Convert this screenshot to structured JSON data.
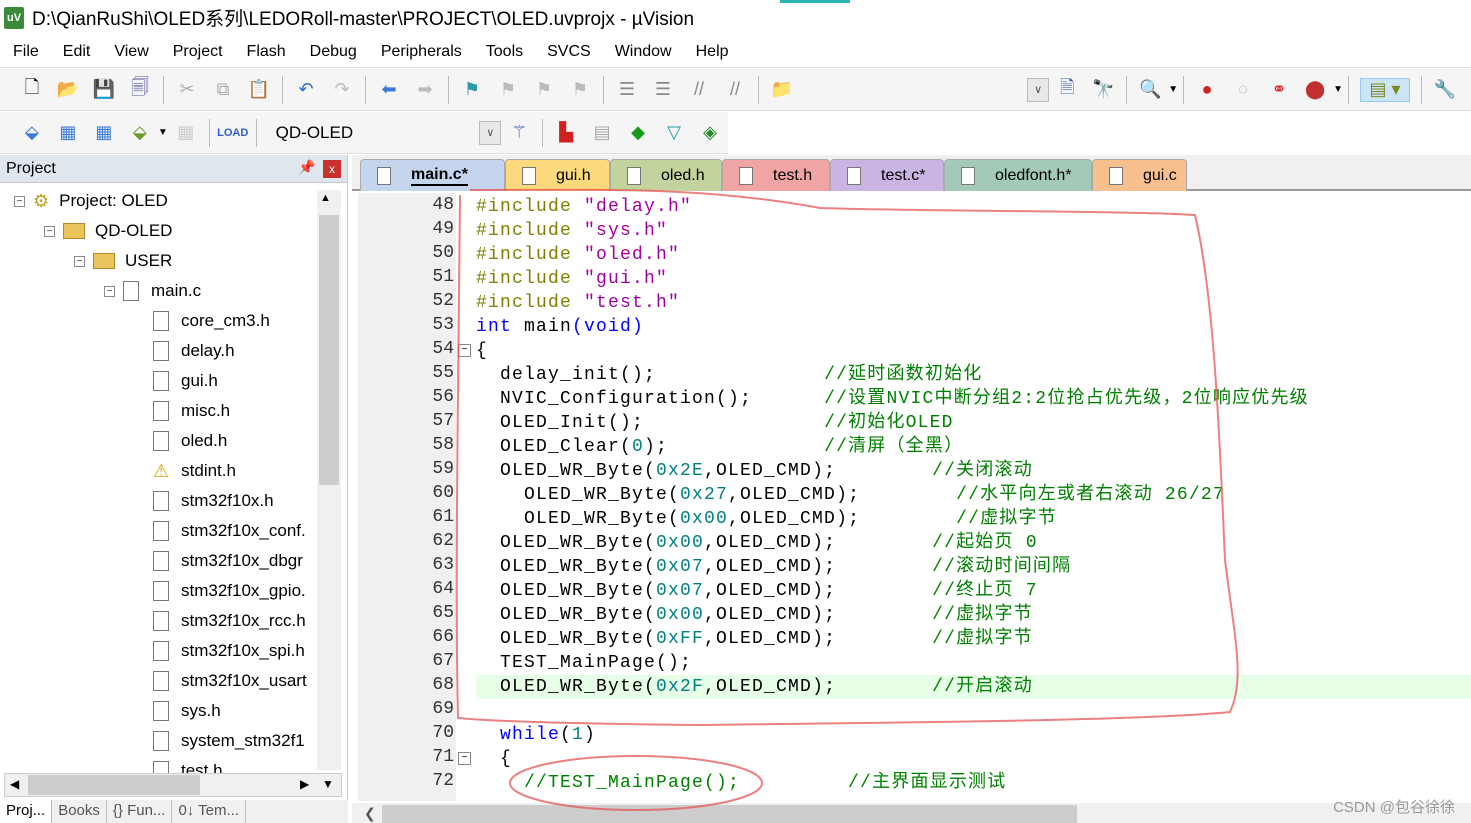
{
  "window": {
    "title": "D:\\QianRuShi\\OLED系列\\LEDORoll-master\\PROJECT\\OLED.uvprojx - µVision",
    "app_icon": "uv"
  },
  "menu": [
    "File",
    "Edit",
    "View",
    "Project",
    "Flash",
    "Debug",
    "Peripherals",
    "Tools",
    "SVCS",
    "Window",
    "Help"
  ],
  "toolbar2": {
    "target": "QD-OLED"
  },
  "project": {
    "title": "Project",
    "pin": "⊥",
    "close": "x",
    "tree": [
      {
        "label": "Project: OLED",
        "level": 0,
        "kind": "project",
        "exp": "−"
      },
      {
        "label": "QD-OLED",
        "level": 1,
        "kind": "folder",
        "exp": "−"
      },
      {
        "label": "USER",
        "level": 2,
        "kind": "folder",
        "exp": "−"
      },
      {
        "label": "main.c",
        "level": 3,
        "kind": "file",
        "exp": "−"
      },
      {
        "label": "core_cm3.h",
        "level": 4,
        "kind": "file"
      },
      {
        "label": "delay.h",
        "level": 4,
        "kind": "file"
      },
      {
        "label": "gui.h",
        "level": 4,
        "kind": "file"
      },
      {
        "label": "misc.h",
        "level": 4,
        "kind": "file"
      },
      {
        "label": "oled.h",
        "level": 4,
        "kind": "file"
      },
      {
        "label": "stdint.h",
        "level": 4,
        "kind": "warn"
      },
      {
        "label": "stm32f10x.h",
        "level": 4,
        "kind": "file"
      },
      {
        "label": "stm32f10x_conf.",
        "level": 4,
        "kind": "file"
      },
      {
        "label": "stm32f10x_dbgr",
        "level": 4,
        "kind": "file"
      },
      {
        "label": "stm32f10x_gpio.",
        "level": 4,
        "kind": "file"
      },
      {
        "label": "stm32f10x_rcc.h",
        "level": 4,
        "kind": "file"
      },
      {
        "label": "stm32f10x_spi.h",
        "level": 4,
        "kind": "file"
      },
      {
        "label": "stm32f10x_usart",
        "level": 4,
        "kind": "file"
      },
      {
        "label": "sys.h",
        "level": 4,
        "kind": "file"
      },
      {
        "label": "system_stm32f1",
        "level": 4,
        "kind": "file"
      },
      {
        "label": "test.h",
        "level": 4,
        "kind": "file"
      }
    ],
    "bottom_tabs": [
      "Proj...",
      "Books",
      "{} Fun...",
      "0↓ Tem..."
    ]
  },
  "tabs": [
    {
      "label": "main.c*",
      "color": "#c5d5ee",
      "active": true
    },
    {
      "label": "gui.h",
      "color": "#fcd97c"
    },
    {
      "label": "oled.h",
      "color": "#c3d39e"
    },
    {
      "label": "test.h",
      "color": "#f0a4a4"
    },
    {
      "label": "test.c*",
      "color": "#c9b4e4"
    },
    {
      "label": "oledfont.h*",
      "color": "#a3c9b8"
    },
    {
      "label": "gui.c",
      "color": "#f8c08e"
    }
  ],
  "code": [
    {
      "n": "48",
      "t": [
        [
          "pp",
          "#include "
        ],
        [
          "str",
          "\"delay.h\""
        ]
      ]
    },
    {
      "n": "49",
      "t": [
        [
          "pp",
          "#include "
        ],
        [
          "str",
          "\"sys.h\""
        ]
      ]
    },
    {
      "n": "50",
      "t": [
        [
          "pp",
          "#include "
        ],
        [
          "str",
          "\"oled.h\""
        ]
      ]
    },
    {
      "n": "51",
      "t": [
        [
          "pp",
          "#include "
        ],
        [
          "str",
          "\"gui.h\""
        ]
      ]
    },
    {
      "n": "52",
      "t": [
        [
          "pp",
          "#include "
        ],
        [
          "str",
          "\"test.h\""
        ]
      ]
    },
    {
      "n": "53",
      "t": [
        [
          "kw",
          "int"
        ],
        [
          "tx",
          " main"
        ],
        [
          "kw",
          "(void)"
        ]
      ]
    },
    {
      "n": "54",
      "t": [
        [
          "tx",
          "{"
        ]
      ],
      "fold": "−"
    },
    {
      "n": "55",
      "t": [
        [
          "tx",
          "  delay_init();              "
        ],
        [
          "cm",
          "//延时函数初始化"
        ]
      ]
    },
    {
      "n": "56",
      "t": [
        [
          "tx",
          "  NVIC_Configuration();      "
        ],
        [
          "cm",
          "//设置NVIC中断分组2:2位抢占优先级，2位响应优先级"
        ]
      ]
    },
    {
      "n": "57",
      "t": [
        [
          "tx",
          "  OLED_Init();               "
        ],
        [
          "cm",
          "//初始化OLED"
        ]
      ]
    },
    {
      "n": "58",
      "t": [
        [
          "tx",
          "  OLED_Clear("
        ],
        [
          "num",
          "0"
        ],
        [
          "tx",
          ");             "
        ],
        [
          "cm",
          "//清屏（全黑）"
        ]
      ]
    },
    {
      "n": "59",
      "t": [
        [
          "tx",
          "  OLED_WR_Byte("
        ],
        [
          "num",
          "0x2E"
        ],
        [
          "tx",
          ",OLED_CMD);        "
        ],
        [
          "cm",
          "//关闭滚动"
        ]
      ]
    },
    {
      "n": "60",
      "t": [
        [
          "tx",
          "    OLED_WR_Byte("
        ],
        [
          "num",
          "0x27"
        ],
        [
          "tx",
          ",OLED_CMD);        "
        ],
        [
          "cm",
          "//水平向左或者右滚动 26/27"
        ]
      ]
    },
    {
      "n": "61",
      "t": [
        [
          "tx",
          "    OLED_WR_Byte("
        ],
        [
          "num",
          "0x00"
        ],
        [
          "tx",
          ",OLED_CMD);        "
        ],
        [
          "cm",
          "//虚拟字节"
        ]
      ]
    },
    {
      "n": "62",
      "t": [
        [
          "tx",
          "  OLED_WR_Byte("
        ],
        [
          "num",
          "0x00"
        ],
        [
          "tx",
          ",OLED_CMD);        "
        ],
        [
          "cm",
          "//起始页 0"
        ]
      ]
    },
    {
      "n": "63",
      "t": [
        [
          "tx",
          "  OLED_WR_Byte("
        ],
        [
          "num",
          "0x07"
        ],
        [
          "tx",
          ",OLED_CMD);        "
        ],
        [
          "cm",
          "//滚动时间间隔"
        ]
      ]
    },
    {
      "n": "64",
      "t": [
        [
          "tx",
          "  OLED_WR_Byte("
        ],
        [
          "num",
          "0x07"
        ],
        [
          "tx",
          ",OLED_CMD);        "
        ],
        [
          "cm",
          "//终止页 7"
        ]
      ]
    },
    {
      "n": "65",
      "t": [
        [
          "tx",
          "  OLED_WR_Byte("
        ],
        [
          "num",
          "0x00"
        ],
        [
          "tx",
          ",OLED_CMD);        "
        ],
        [
          "cm",
          "//虚拟字节"
        ]
      ]
    },
    {
      "n": "66",
      "t": [
        [
          "tx",
          "  OLED_WR_Byte("
        ],
        [
          "num",
          "0xFF"
        ],
        [
          "tx",
          ",OLED_CMD);        "
        ],
        [
          "cm",
          "//虚拟字节"
        ]
      ]
    },
    {
      "n": "67",
      "t": [
        [
          "tx",
          "  TEST_MainPage();"
        ]
      ]
    },
    {
      "n": "68",
      "t": [
        [
          "tx",
          "  OLED_WR_Byte("
        ],
        [
          "num",
          "0x2F"
        ],
        [
          "tx",
          ",OLED_CMD);        "
        ],
        [
          "cm",
          "//开启滚动"
        ]
      ],
      "current": true
    },
    {
      "n": "69",
      "t": []
    },
    {
      "n": "70",
      "t": [
        [
          "kw",
          "  while"
        ],
        [
          "tx",
          "("
        ],
        [
          "num",
          "1"
        ],
        [
          "tx",
          ")"
        ]
      ]
    },
    {
      "n": "71",
      "t": [
        [
          "tx",
          "  {"
        ]
      ],
      "fold": "−"
    },
    {
      "n": "72",
      "t": [
        [
          "cm",
          "    //TEST_MainPage();         //主界面显示测试"
        ]
      ]
    }
  ],
  "watermark": "CSDN @包谷徐徐",
  "colors": {
    "preprocessor": "#808000",
    "string": "#a000a0",
    "keyword": "#0000ff",
    "number": "#008080",
    "comment": "#008000",
    "annotation": "#e05050"
  }
}
